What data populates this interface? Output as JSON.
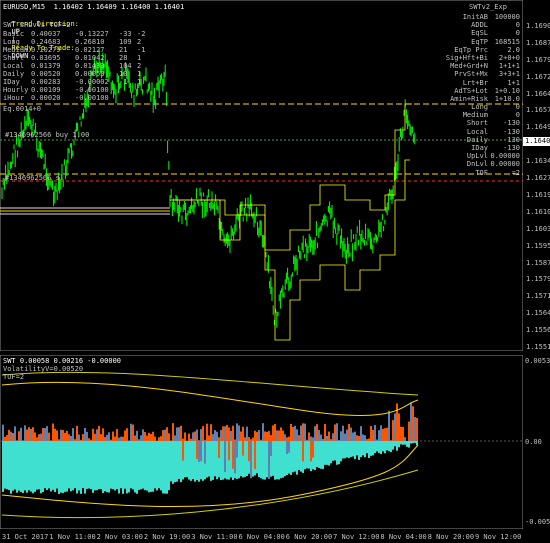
{
  "main": {
    "symbol_header": "EURUSD,M15  1.16402 1.16409 1.16400 1.16401",
    "trend_direction_label": "Trend Direction:",
    "trend_direction_value": "UP",
    "ready_label": "Ready To Trade:",
    "ready_value": "DOWN",
    "panel_title": "SWT_SRLvls TOF=2",
    "stats_rows": [
      {
        "name": "Basic",
        "v1": "0.40037",
        "v2": "-0.13227",
        "v3": "-33",
        "v4": "-2"
      },
      {
        "name": "Long",
        "v1": "0.24683",
        "v2": "0.26810",
        "v3": "109",
        "v4": "2"
      },
      {
        "name": "Medium",
        "v1": "0.10279",
        "v2": "0.02127",
        "v3": "21",
        "v4": "-1"
      },
      {
        "name": "Short",
        "v1": "0.03695",
        "v2": "0.01042",
        "v3": "28",
        "v4": "1"
      },
      {
        "name": "Local",
        "v1": "0.01379",
        "v2": "0.01433",
        "v3": "104",
        "v4": "2"
      },
      {
        "name": "Daily",
        "v1": "0.00520",
        "v2": "0.00053",
        "v3": "10",
        "v4": "1"
      },
      {
        "name": "IDay",
        "v1": "0.00283",
        "v2": "-0.00002",
        "v3": "-1",
        "v4": "1"
      },
      {
        "name": "Hourly",
        "v1": "0.00109",
        "v2": "-0.00100",
        "v3": "",
        "v4": ""
      },
      {
        "name": "iHour",
        "v1": "0.00020",
        "v2": "-0.00100",
        "v3": "",
        "v4": ""
      }
    ],
    "extra_label": "Eq.0014+0",
    "order_label_1": "#1346962566 buy 1.00",
    "order_label_2": "#1346962566 sl",
    "right_panel_title": "SWTv2_Exp",
    "right_panel_rows": [
      {
        "name": "InitAB",
        "value": "100000"
      },
      {
        "name": "ADDL",
        "value": "0"
      },
      {
        "name": "EqSL",
        "value": "0"
      },
      {
        "name": "EqTP",
        "value": "168515"
      },
      {
        "name": "EqTp Prc",
        "value": "2.0"
      },
      {
        "name": "Sig+Hft+Bi",
        "value": "2+0+0"
      },
      {
        "name": "Med+Grd+N",
        "value": "1+1+1"
      },
      {
        "name": "PrvSt+Mx",
        "value": "3+3+1"
      },
      {
        "name": "Lrt+Br",
        "value": "1+1"
      },
      {
        "name": "AdTS+Lot",
        "value": "1+0.10"
      },
      {
        "name": "Amin+Risk",
        "value": "1+10.0"
      },
      {
        "name": "Long",
        "value": "0"
      },
      {
        "name": "Medium",
        "value": "0"
      },
      {
        "name": "Short",
        "value": "-130"
      },
      {
        "name": "Local",
        "value": "-130"
      },
      {
        "name": "Daily",
        "value": "-130"
      },
      {
        "name": "IDay",
        "value": "-130"
      },
      {
        "name": "UpLvl",
        "value": "0.00000"
      },
      {
        "name": "DnLvl",
        "value": "0.00000"
      },
      {
        "name": "TOF",
        "value": "=2"
      }
    ],
    "price_axis": [
      "1.16905",
      "1.16870",
      "1.16795",
      "1.16720",
      "1.16645",
      "1.16570",
      "1.16495",
      "1.16420",
      "1.16345",
      "1.16275",
      "1.16195",
      "1.16105",
      "1.16030",
      "1.15950",
      "1.15875",
      "1.15790",
      "1.15715",
      "1.15640",
      "1.15565",
      "1.15510"
    ],
    "current_price": "1.16401"
  },
  "sub": {
    "header": "SWT 0.00058 0.00216 -0.00000",
    "line2": "VolatilityV=0.00520",
    "line3": "TOF=2",
    "axis": [
      "0.0053",
      "0.00",
      "-0.0052"
    ]
  },
  "time_axis": [
    "31 Oct 2017",
    "1 Nov 11:00",
    "2 Nov 03:00",
    "2 Nov 19:00",
    "3 Nov 11:00",
    "6 Nov 04:00",
    "6 Nov 20:00",
    "7 Nov 12:00",
    "8 Nov 04:00",
    "8 Nov 20:00",
    "9 Nov 12:00"
  ],
  "colors": {
    "background": "#000000",
    "candles": "#00ff00",
    "yellow": "#ffff00",
    "orange": "#ff6600",
    "cyan": "#40e0d0",
    "steel": "#6080b0",
    "red": "#ff3030"
  }
}
